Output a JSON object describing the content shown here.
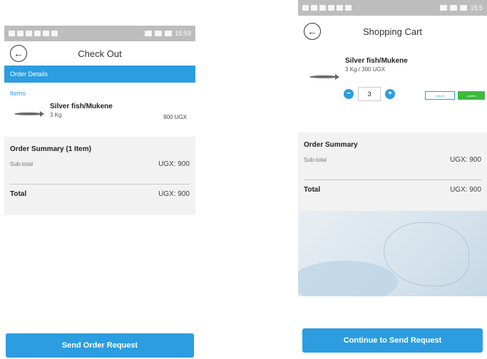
{
  "left": {
    "header_title": "Check Out",
    "section_bar": "Order Details",
    "items_label": "Items",
    "item": {
      "name": "Silver fish/Mukene",
      "qty": "3 Kg",
      "price": "900 UGX"
    },
    "summary": {
      "title": "Order Summary (1 Item)",
      "subtotal_label": "Sub-total",
      "subtotal_value": "UGX: 900",
      "total_label": "Total",
      "total_value": "UGX: 900"
    },
    "button": "Send Order Request",
    "status_time": "15:59"
  },
  "right": {
    "header_title": "Shopping Cart",
    "item": {
      "name": "Silver fish/Mukene",
      "qty": "3 Kg / 300 UGX"
    },
    "stepper_value": "3",
    "remove_label": "remove",
    "confirm_label": "confirm",
    "summary": {
      "title": "Order Summary",
      "subtotal_label": "Sub-total",
      "subtotal_value": "UGX: 900",
      "total_label": "Total",
      "total_value": "UGX: 900"
    },
    "button": "Continue to Send Request",
    "status_time": "15:5"
  },
  "colors": {
    "accent": "#2b9de0",
    "confirm": "#3cba3c",
    "status_bar": "#bdbdbd",
    "summary_bg": "#f2f2f2"
  },
  "icons": {
    "back": "back-arrow-icon",
    "fish": "fish-icon",
    "minus": "minus-icon",
    "plus": "plus-icon"
  }
}
